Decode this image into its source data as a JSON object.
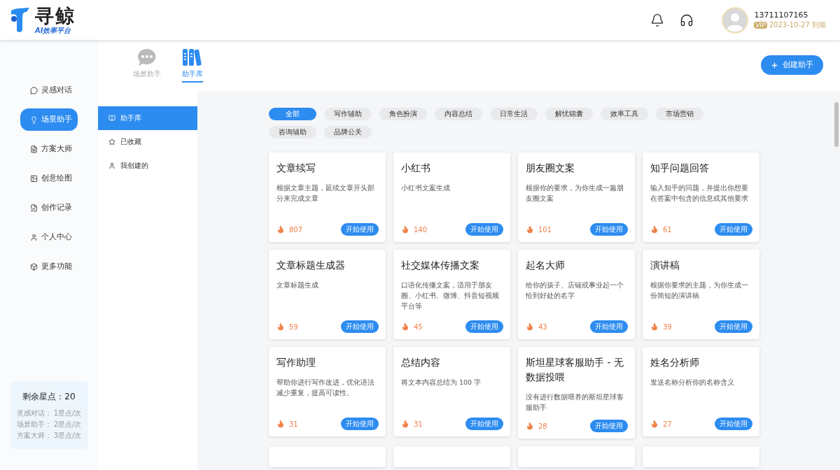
{
  "header": {
    "logo_name": "寻鲸",
    "logo_tagline": "AI效率平台",
    "user": {
      "phone": "13711107165",
      "vip_badge": "VIP",
      "expiry": "2023-10-27 到期"
    }
  },
  "nav": [
    {
      "label": "灵感对话",
      "selected": false
    },
    {
      "label": "场景助手",
      "selected": true
    },
    {
      "label": "方案大师",
      "selected": false
    },
    {
      "label": "创意绘图",
      "selected": false
    },
    {
      "label": "创作记录",
      "selected": false
    },
    {
      "label": "个人中心",
      "selected": false
    },
    {
      "label": "更多功能",
      "selected": false
    }
  ],
  "points": {
    "title": "剩余星点：",
    "value": "20",
    "rates": [
      {
        "label": "灵感对话：",
        "value": "1星点/次"
      },
      {
        "label": "场景助手：",
        "value": "2星点/次"
      },
      {
        "label": "方案大师：",
        "value": "3星点/次"
      }
    ]
  },
  "top_tabs": [
    {
      "label": "场景助手",
      "selected": false
    },
    {
      "label": "助手库",
      "selected": true
    }
  ],
  "create_button": "创建助手",
  "sub_nav": [
    {
      "label": "助手库",
      "selected": true
    },
    {
      "label": "已收藏",
      "selected": false
    },
    {
      "label": "我创建的",
      "selected": false
    }
  ],
  "categories": [
    {
      "label": "全部",
      "selected": true
    },
    {
      "label": "写作辅助",
      "selected": false
    },
    {
      "label": "角色扮演",
      "selected": false
    },
    {
      "label": "内容总结",
      "selected": false
    },
    {
      "label": "日常生活",
      "selected": false
    },
    {
      "label": "解忧锦囊",
      "selected": false
    },
    {
      "label": "效率工具",
      "selected": false
    },
    {
      "label": "市场营销",
      "selected": false
    },
    {
      "label": "咨询辅助",
      "selected": false
    },
    {
      "label": "品牌公关",
      "selected": false
    }
  ],
  "cards": [
    {
      "kind": "card",
      "title": "文章续写",
      "description": "根据文章主题，延续文章开头部分来完成文章",
      "count": "807",
      "button": "开始使用"
    },
    {
      "kind": "card",
      "title": "小红书",
      "description": "小红书文案生成",
      "count": "140",
      "button": "开始使用"
    },
    {
      "kind": "card",
      "title": "朋友圈文案",
      "description": "根据你的要求，为你生成一篇朋友圈文案",
      "count": "101",
      "button": "开始使用"
    },
    {
      "kind": "card",
      "title": "知乎问题回答",
      "description": "输入知乎的问题，并提出你想要在答案中包含的信息或其他要求",
      "count": "61",
      "button": "开始使用"
    },
    {
      "kind": "card",
      "title": "文章标题生成器",
      "description": "文章标题生成",
      "count": "59",
      "button": "开始使用"
    },
    {
      "kind": "card",
      "title": "社交媒体传播文案",
      "description": "口语化传播文案，适用于朋友圈、小红书、微博、抖音短视频平台等",
      "count": "45",
      "button": "开始使用"
    },
    {
      "kind": "card",
      "title": "起名大师",
      "description": "给你的孩子、店铺或事业起一个恰到好处的名字",
      "count": "43",
      "button": "开始使用"
    },
    {
      "kind": "card",
      "title": "演讲稿",
      "description": "根据你要求的主题，为你生成一份简短的演讲稿",
      "count": "39",
      "button": "开始使用"
    },
    {
      "kind": "card",
      "title": "写作助理",
      "description": "帮助你进行写作改进，优化语法减少重复，提高可读性。",
      "count": "31",
      "button": "开始使用"
    },
    {
      "kind": "card",
      "title": "总结内容",
      "description": "将文本内容总结为 100 字",
      "count": "31",
      "button": "开始使用"
    },
    {
      "kind": "card",
      "title": "斯坦星球客服助手 - 无数据投喂",
      "description": "没有进行数据喂养的斯坦星球客服助手",
      "count": "28",
      "button": "开始使用"
    },
    {
      "kind": "card",
      "title": "姓名分析师",
      "description": "发送名称分析你的名称含义",
      "count": "27",
      "button": "开始使用"
    },
    {
      "kind": "cut_off"
    },
    {
      "kind": "cut_off"
    },
    {
      "kind": "cut_off"
    },
    {
      "kind": "cut_off"
    }
  ]
}
